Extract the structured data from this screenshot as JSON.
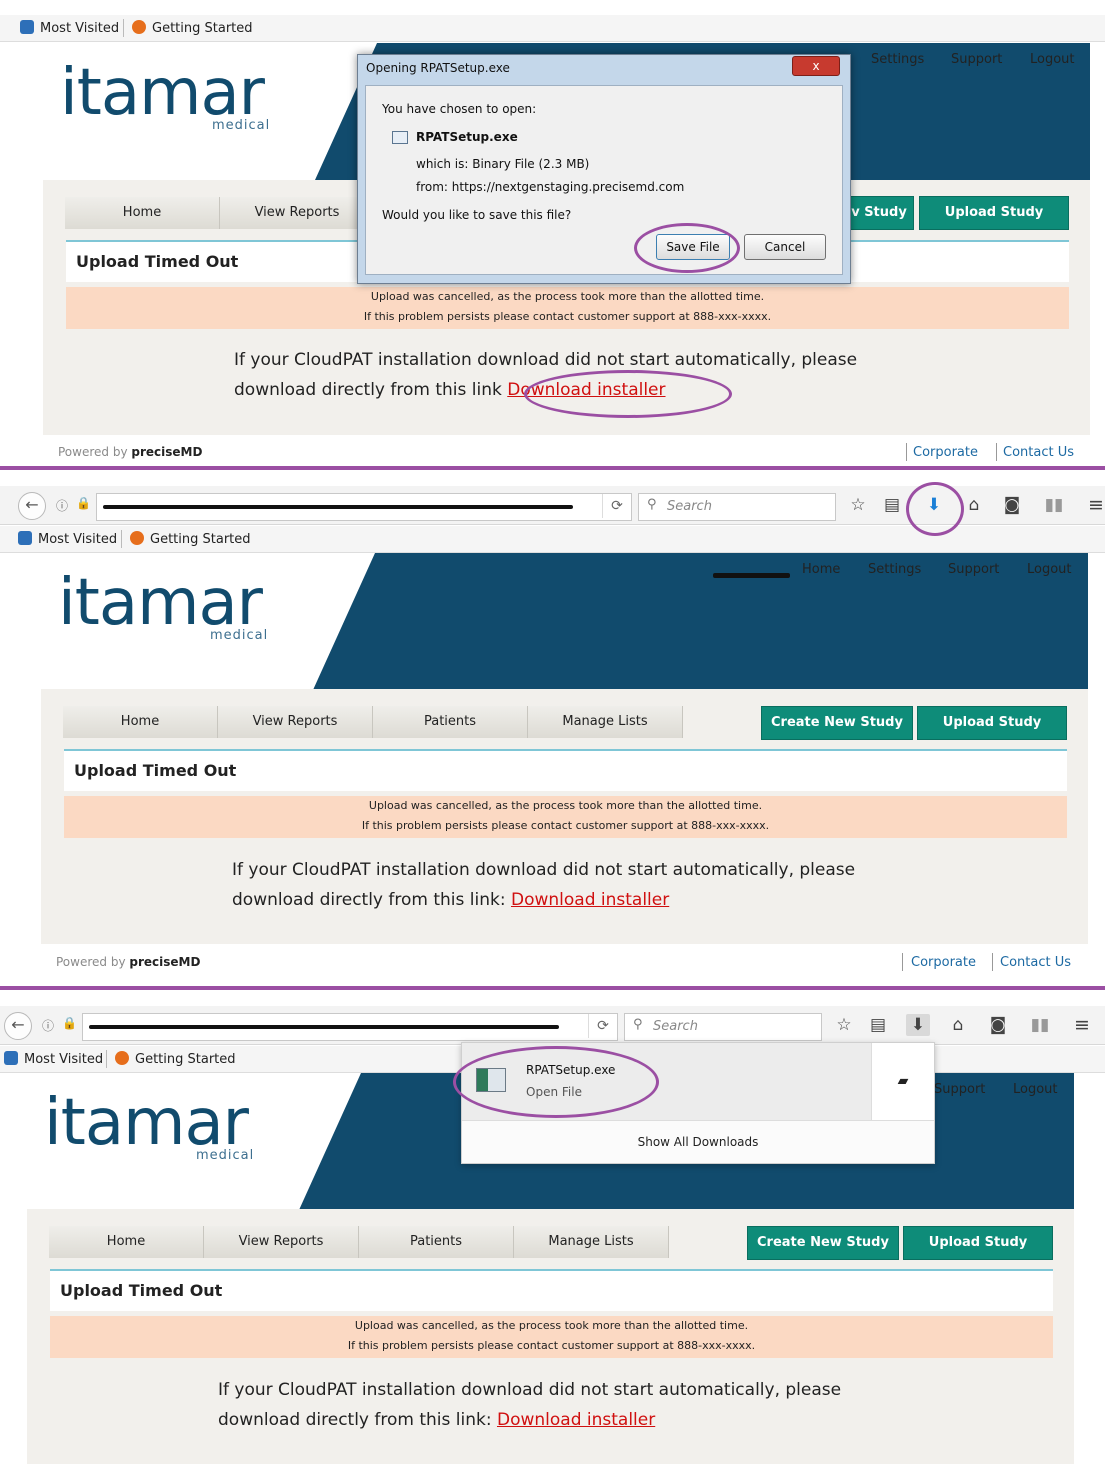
{
  "browser": {
    "search_placeholder": "Search",
    "bookmarks": [
      "Most Visited",
      "Getting Started"
    ]
  },
  "site": {
    "logo": "itamar",
    "logo_sub": "medical",
    "top_nav": [
      "Home",
      "Settings",
      "Support",
      "Logout"
    ],
    "tabs": [
      "Home",
      "View Reports",
      "Patients",
      "Manage Lists"
    ],
    "create_study": "Create New Study",
    "upload_study": "Upload Study",
    "create_study_partial": "v Study",
    "section_title": "Upload Timed Out",
    "alert_line1": "Upload was cancelled, as the process took more than the allotted time.",
    "alert_line2": "If this problem persists please contact customer support at 888-xxx-xxxx.",
    "msg_line1": "If your CloudPAT installation download did not start automatically, please",
    "msg_line2_prefix": "download directly from this link: ",
    "msg_line2_prefix_partial": "download directly from this link",
    "download_link": "Download installer",
    "footer_powered": "Powered by",
    "footer_brand": "preciseMD",
    "footer_corporate": "Corporate",
    "footer_contact": "Contact Us"
  },
  "dialog": {
    "title": "Opening RPATSetup.exe",
    "close": "x",
    "chosen": "You have chosen to open:",
    "filename": "RPATSetup.exe",
    "which_is": "which is:",
    "type": "Binary File (2.3 MB)",
    "from_label": "from:",
    "from_url": "https://nextgenstaging.precisemd.com",
    "question": "Would you like to save this file?",
    "save": "Save File",
    "cancel": "Cancel"
  },
  "downloads_panel": {
    "filename": "RPATSetup.exe",
    "status": "Open File",
    "show_all": "Show All Downloads"
  },
  "colors": {
    "brand_blue": "#114b6d",
    "teal": "#0e8c79",
    "alert_bg": "#fbd9c3",
    "annotation": "#9b4fa3",
    "link_red": "#d01010"
  }
}
